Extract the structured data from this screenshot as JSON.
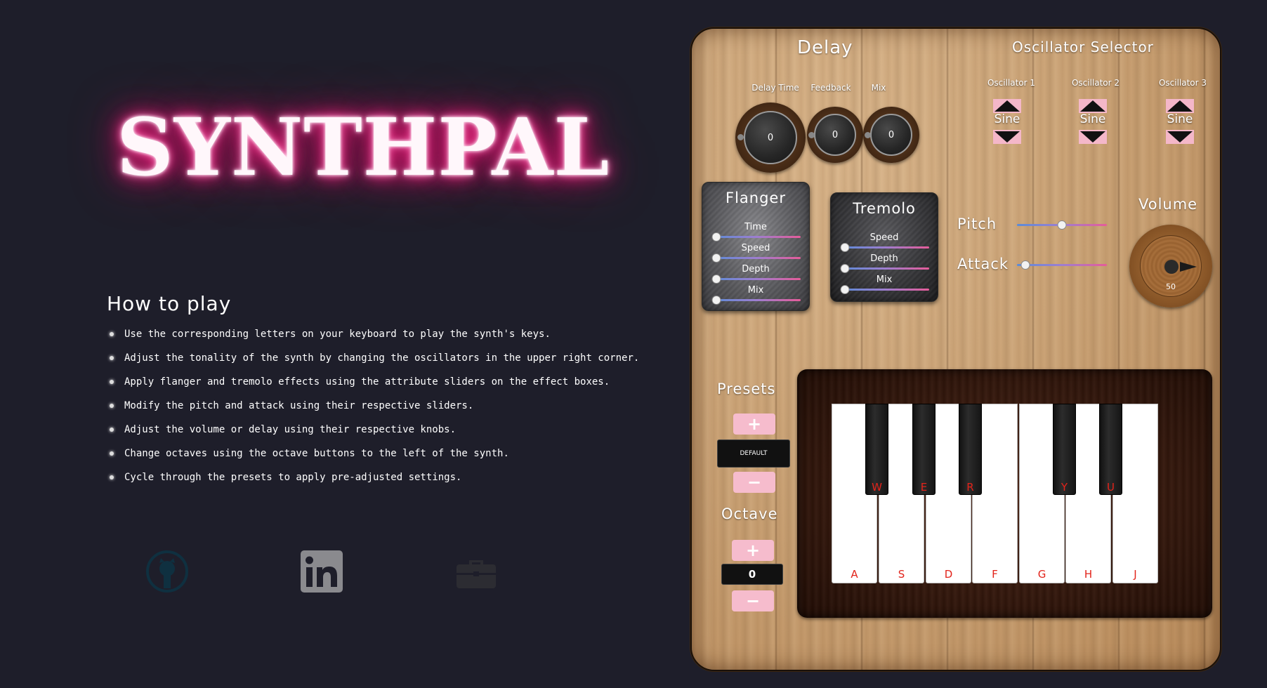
{
  "app": {
    "logo": "SYNTHPAL"
  },
  "how_to_play": {
    "title": "How to play",
    "items": [
      "Use the corresponding letters on your keyboard to play the synth's keys.",
      "Adjust the tonality of the synth by changing the oscillators in the upper right corner.",
      "Apply flanger and tremolo effects using the attribute sliders on the effect boxes.",
      "Modify the pitch and attack using their respective sliders.",
      "Adjust the volume or delay using their respective knobs.",
      "Change octaves using the octave buttons to the left of the synth.",
      "Cycle through the presets to apply pre-adjusted settings."
    ]
  },
  "social": [
    {
      "icon": "github-icon"
    },
    {
      "icon": "linkedin-icon"
    },
    {
      "icon": "briefcase-icon"
    }
  ],
  "delay": {
    "title": "Delay",
    "knobs": [
      {
        "label": "Delay Time",
        "value": "0"
      },
      {
        "label": "Feedback",
        "value": "0"
      },
      {
        "label": "Mix",
        "value": "0"
      }
    ]
  },
  "oscillator_selector": {
    "title": "Oscillator Selector",
    "oscillators": [
      {
        "label": "Oscillator 1",
        "value": "Sine"
      },
      {
        "label": "Oscillator 2",
        "value": "Sine"
      },
      {
        "label": "Oscillator 3",
        "value": "Sine"
      }
    ]
  },
  "flanger": {
    "title": "Flanger",
    "sliders": [
      {
        "label": "Time",
        "level": 0
      },
      {
        "label": "Speed",
        "level": 0
      },
      {
        "label": "Depth",
        "level": 0
      },
      {
        "label": "Mix",
        "level": 0
      }
    ]
  },
  "tremolo": {
    "title": "Tremolo",
    "sliders": [
      {
        "label": "Speed",
        "level": 0
      },
      {
        "label": "Depth",
        "level": 0
      },
      {
        "label": "Mix",
        "level": 0
      }
    ]
  },
  "pitch": {
    "label": "Pitch",
    "level": 0.5
  },
  "attack": {
    "label": "Attack",
    "level": 0.05
  },
  "volume": {
    "title": "Volume",
    "value": "50"
  },
  "presets": {
    "title": "Presets",
    "plus": "+",
    "minus": "−",
    "current": "DEFAULT"
  },
  "octave": {
    "title": "Octave",
    "plus": "+",
    "minus": "−",
    "current": "0"
  },
  "keyboard": {
    "white_keys": [
      "A",
      "S",
      "D",
      "F",
      "G",
      "H",
      "J"
    ],
    "black_keys": [
      "W",
      "E",
      "R",
      "Y",
      "U"
    ]
  },
  "colors": {
    "background": "#1e1e2a",
    "neon_pink": "#ff2f8c",
    "button_pink": "#f6bccd",
    "key_label_red": "#e2231a"
  }
}
